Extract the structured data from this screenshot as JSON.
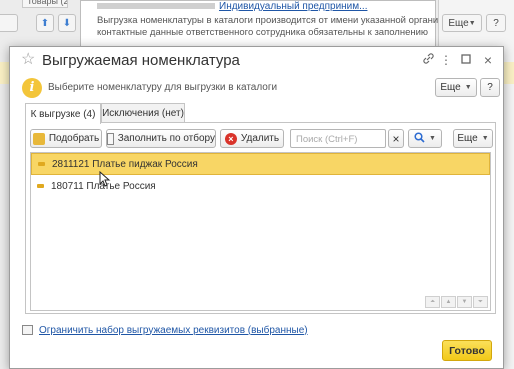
{
  "background": {
    "tab_label": "Товары (2)",
    "more_button": "Еще",
    "link_text": "Индивидуальный предприним...",
    "info_line1": "Выгрузка номенклатуры в каталоги производится от имени указанной организации,",
    "info_line2": "контактные данные ответственного сотрудника обязательны к заполнению"
  },
  "dialog": {
    "title": "Выгружаемая номенклатура",
    "info_text": "Выберите номенклатуру для выгрузки в каталоги",
    "more_button": "Еще",
    "help_button": "?",
    "tabs": [
      {
        "label": "К выгрузке (4)",
        "active": true
      },
      {
        "label": "Исключения (нет)",
        "active": false
      }
    ],
    "toolbar": {
      "pick_label": "Подобрать",
      "fill_label": "Заполнить по отбору",
      "delete_label": "Удалить",
      "search_placeholder": "Поиск (Ctrl+F)",
      "search_clear": "×",
      "more_label": "Еще"
    },
    "rows": [
      {
        "text": "2811121 Платье пиджак Россия",
        "selected": true
      },
      {
        "text": "180711 Платье Россия",
        "selected": false
      }
    ],
    "limit_link": "Ограничить набор выгружаемых реквизитов (выбранные)",
    "done_button": "Готово"
  },
  "colors": {
    "accent_yellow": "#f2c918",
    "selected_row": "#f8d665",
    "link_blue": "#1f56a6"
  }
}
